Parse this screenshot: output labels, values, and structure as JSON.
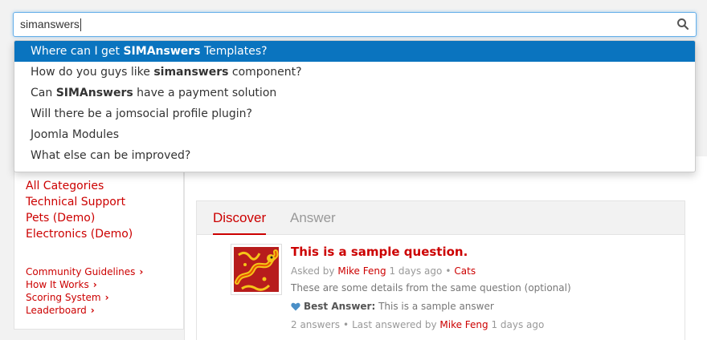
{
  "search": {
    "value": "simanswers"
  },
  "suggestions": [
    {
      "pre": "Where can I get ",
      "bold": "SIMAnswers",
      "post": " Templates?"
    },
    {
      "pre": "How do you guys like ",
      "bold": "simanswers",
      "post": " component?"
    },
    {
      "pre": "Can ",
      "bold": "SIMAnswers",
      "post": " have a payment solution"
    },
    {
      "pre": "Will there be a jomsocial profile plugin?",
      "bold": "",
      "post": ""
    },
    {
      "pre": "Joomla Modules",
      "bold": "",
      "post": ""
    },
    {
      "pre": "What else can be improved?",
      "bold": "",
      "post": ""
    }
  ],
  "categories": [
    "All Categories",
    "Technical Support",
    "Pets (Demo)",
    "Electronics (Demo)"
  ],
  "links": [
    "Community Guidelines",
    "How It Works",
    "Scoring System",
    "Leaderboard"
  ],
  "tabs": {
    "discover": "Discover",
    "answer": "Answer"
  },
  "question": {
    "title": "This is a sample question.",
    "asked_by_label": "Asked by",
    "author": "Mike Feng",
    "asked_time": "1 days ago",
    "category": "Cats",
    "details": "These are some details from the same question (optional)",
    "best_answer_label": "Best Answer:",
    "best_answer_text": "This is a sample answer",
    "answers_count": "2 answers",
    "last_answered_label": "Last answered by",
    "last_answered_by": "Mike Feng",
    "last_answered_time": "1 days ago"
  },
  "colors": {
    "accent": "#cc0000",
    "selection": "#0a74bf",
    "heart": "#4a8fc7"
  },
  "icons": {
    "search": "search-icon",
    "heart": "heart-icon",
    "chevron": "chevron-right-icon"
  }
}
